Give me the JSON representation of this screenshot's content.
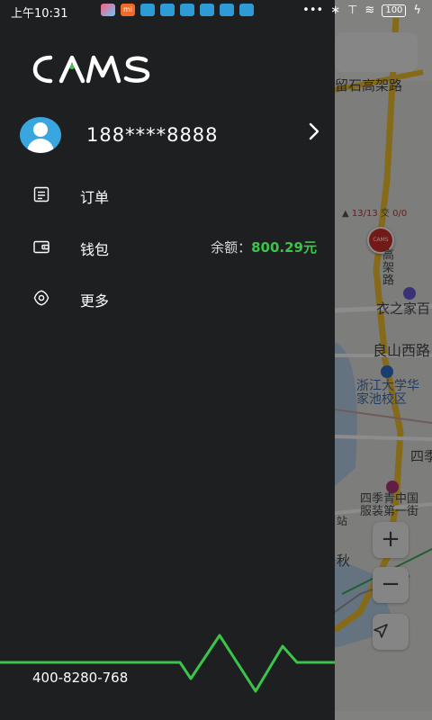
{
  "status_bar": {
    "time": "上午10:31",
    "mi_label": "mi",
    "battery": "100"
  },
  "drawer": {
    "user_phone": "188****8888",
    "menu": [
      {
        "label": "订单",
        "icon": "order-list-icon"
      },
      {
        "label": "钱包",
        "icon": "wallet-icon"
      },
      {
        "label": "更多",
        "icon": "settings-gear-icon"
      }
    ],
    "balance_label": "余额：",
    "balance_amount": "800.29元",
    "hotline": "400-8280-768"
  },
  "map": {
    "labels": {
      "road_top": "留石高架路",
      "road_vertical": "秋涛北路",
      "road_vertical_short": "高架路",
      "counter_left": "13/13",
      "counter_mid": "交",
      "counter_right": "0/0",
      "poi_store": "衣之家百",
      "road_liangshan": "良山西路",
      "poi_university": "浙江大学华家池校区",
      "poi_ji": "四季",
      "poi_sijiqing": "四季青中国服装第一街",
      "station_fragment": "站",
      "road_qiu": "秋"
    },
    "pin_text": "CAMS",
    "zoom_in": "+",
    "zoom_out": "−"
  },
  "colors": {
    "drawer_bg": "#1e1f21",
    "accent_green": "#3bc44a",
    "avatar_blue": "#3aa6e0"
  }
}
